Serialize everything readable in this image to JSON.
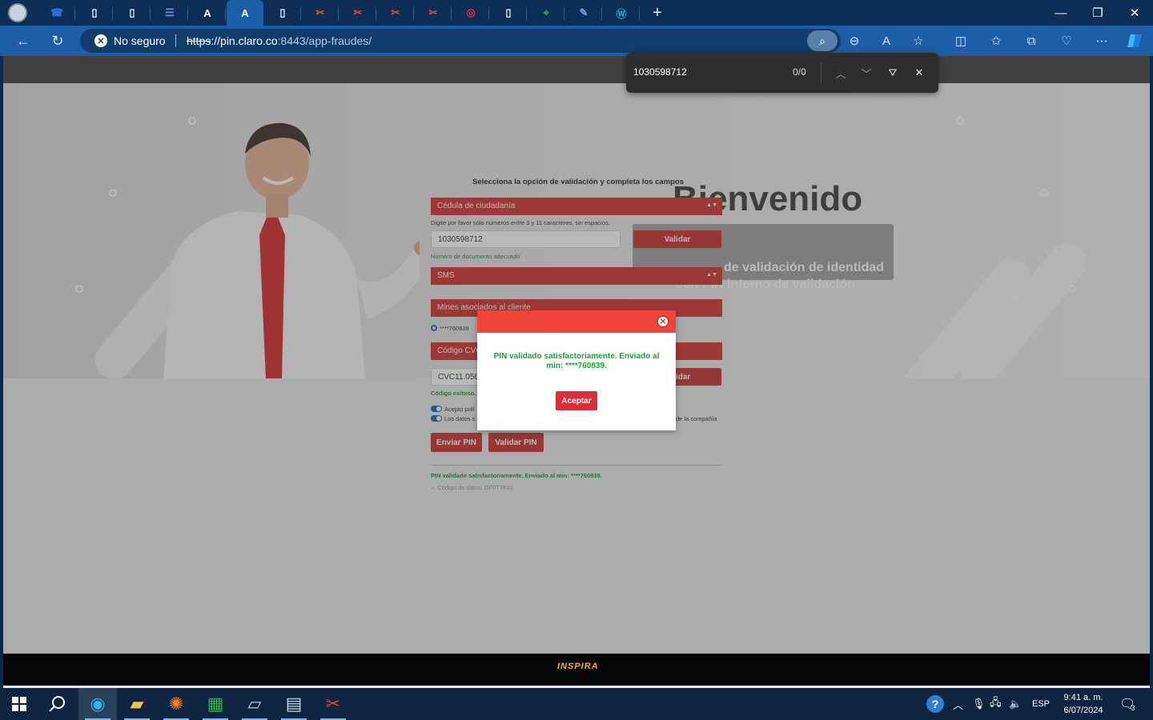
{
  "browser": {
    "tabs": [
      {
        "icon": "phone-icon"
      },
      {
        "icon": "page-icon"
      },
      {
        "icon": "page-icon"
      },
      {
        "icon": "list-icon"
      },
      {
        "icon": "a-logo-icon"
      },
      {
        "icon": "a-logo-icon",
        "active": true
      },
      {
        "icon": "page-icon"
      },
      {
        "icon": "scissors-icon"
      },
      {
        "icon": "scissors-icon"
      },
      {
        "icon": "scissors-icon"
      },
      {
        "icon": "scissors-icon"
      },
      {
        "icon": "claro-icon"
      },
      {
        "icon": "page-icon"
      },
      {
        "icon": "map-pin-icon"
      },
      {
        "icon": "pen-icon"
      },
      {
        "icon": "tw-icon"
      }
    ],
    "new_tab_glyph": "+",
    "security_label": "No seguro",
    "url_scheme": "https",
    "url_host": "://pin.claro.co",
    "url_rest": ":8443/app-fraudes/",
    "find": {
      "query": "1030598712",
      "count": "0/0"
    }
  },
  "page": {
    "welcome_title": "Bienvenido",
    "welcome_sub1": "de validación de identidad",
    "welcome_sub2": "con PIN interno de validación",
    "form_title": "Selecciona la opción de validación y completa los campos",
    "doc_type_select": "Cédula de ciudadanía",
    "doc_hint": "Digite por favor sólo números entre 3 y 11 caracteres, sin espacios.",
    "doc_value": "1030598712",
    "validar_label": "Validar",
    "doc_ok": "Número de documento adecuado",
    "channel_select": "SMS",
    "mines_select": "Mines asociados al cliente",
    "mines_option": "****760839",
    "code_select": "Código CVC",
    "code_value": "CVC11.056",
    "code_validar_label": "Validar",
    "code_ok": "Código exitoso.",
    "accept_policy": "Acepto polí",
    "data_policy": "Los datos s",
    "data_policy_end": "de la compañía",
    "send_pin_label": "Enviar PIN",
    "validate_pin_label": "Validar PIN",
    "status_success": "PIN validado satisfactoriamente. Enviado al min: ****760839.",
    "status_code": "✓ Código de datos: DF0T7F01",
    "footer_logo": "INSPIRA"
  },
  "modal": {
    "message": "PIN validado satisfactoriamente. Enviado al min: ****760839.",
    "accept_label": "Aceptar"
  },
  "taskbar": {
    "apps": [
      "edge-icon",
      "folder-icon",
      "app-orange-icon",
      "spreadsheet-icon",
      "notepad-icon",
      "calculator-icon",
      "snip-icon"
    ],
    "lang": "ESP",
    "time": "9:41 a. m.",
    "date": "6/07/2024",
    "notifications": "3"
  },
  "colors": {
    "accent_red": "#c9302c",
    "success_green": "#1e8c33",
    "browser_blue": "#1c5fa8"
  }
}
